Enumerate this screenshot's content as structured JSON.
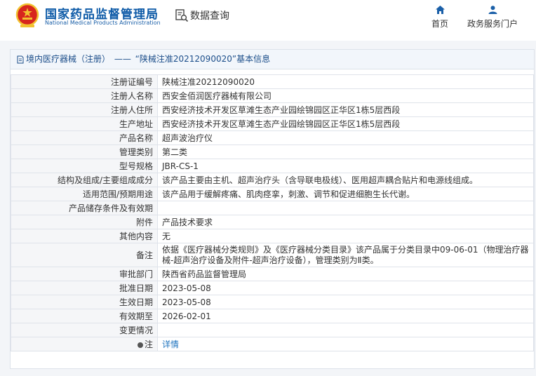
{
  "header": {
    "site_name_cn": "国家药品监督管理局",
    "site_name_en": "National Medical Products Administration",
    "query_label": "数据查询",
    "nav": [
      {
        "label": "首页",
        "icon": "home-icon"
      },
      {
        "label": "政务服务门户",
        "icon": "user-icon"
      }
    ]
  },
  "panel": {
    "title_prefix": "境内医疗器械（注册）",
    "title_sep": " —— ",
    "title_main": "“陕械注准20212090020”基本信息"
  },
  "rows": [
    {
      "label": "注册证编号",
      "value": "陕械注准20212090020"
    },
    {
      "label": "注册人名称",
      "value": "西安金佰润医疗器械有限公司"
    },
    {
      "label": "注册人住所",
      "value": "西安经济技术开发区草滩生态产业园绘锦园区正华区1栋5层西段"
    },
    {
      "label": "生产地址",
      "value": "西安经济技术开发区草滩生态产业园绘锦园区正华区1栋5层西段"
    },
    {
      "label": "产品名称",
      "value": "超声波治疗仪"
    },
    {
      "label": "管理类别",
      "value": "第二类"
    },
    {
      "label": "型号规格",
      "value": "JBR-CS-1"
    },
    {
      "label": "结构及组成/主要组成成分",
      "value": "该产品主要由主机、超声治疗头（含导联电极线）、医用超声耦合贴片和电源线组成。"
    },
    {
      "label": "适用范围/预期用途",
      "value": "该产品用于缓解疼痛、肌肉痉挛，刺激、调节和促进细胞生长代谢。"
    },
    {
      "label": "产品储存条件及有效期",
      "value": ""
    },
    {
      "label": "附件",
      "value": "产品技术要求"
    },
    {
      "label": "其他内容",
      "value": "无"
    },
    {
      "label": "备注",
      "value": "依据《医疗器械分类规则》及《医疗器械分类目录》该产品属于分类目录中09-06-01（物理治疗器械-超声治疗设备及附件-超声治疗设备），管理类别为Ⅱ类。"
    },
    {
      "label": "审批部门",
      "value": "陕西省药品监督管理局"
    },
    {
      "label": "批准日期",
      "value": "2023-05-08"
    },
    {
      "label": "生效日期",
      "value": "2023-05-08"
    },
    {
      "label": "有效期至",
      "value": "2026-02-01"
    },
    {
      "label": "变更情况",
      "value": ""
    }
  ],
  "note_row": {
    "label": "注",
    "link": "详情"
  },
  "colors": {
    "brand": "#0d5aa7",
    "link": "#1e73be",
    "emblem_red": "#d7261e",
    "emblem_gold": "#f2c230"
  }
}
